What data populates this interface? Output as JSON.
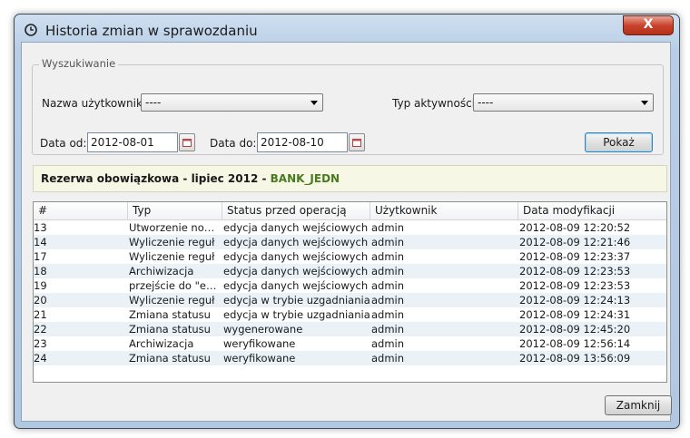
{
  "window": {
    "title": "Historia zmian w sprawozdaniu",
    "close_label": "X"
  },
  "search": {
    "legend": "Wyszukiwanie",
    "user_label": "Nazwa użytkownika:",
    "user_value": "----",
    "activity_label": "Typ aktywności:",
    "activity_value": "----",
    "date_from_label": "Data od:",
    "date_from_value": "2012-08-01",
    "date_to_label": "Data do:",
    "date_to_value": "2012-08-10",
    "show_button": "Pokaż"
  },
  "report": {
    "title": "Rezerwa obowiązkowa - lipiec 2012 - ",
    "unit": "BANK_JEDN"
  },
  "table": {
    "columns": [
      "#",
      "Typ",
      "Status przed operacją",
      "Użytkownik",
      "Data modyfikacji"
    ],
    "rows": [
      [
        "13",
        "Utworzenie nowe...",
        "edycja danych wejściowych",
        "admin",
        "2012-08-09 12:20:52"
      ],
      [
        "14",
        "Wyliczenie reguł",
        "edycja danych wejściowych",
        "admin",
        "2012-08-09 12:21:46"
      ],
      [
        "17",
        "Wyliczenie reguł",
        "edycja danych wejściowych",
        "admin",
        "2012-08-09 12:23:37"
      ],
      [
        "18",
        "Archiwizacja",
        "edycja danych wejściowych",
        "admin",
        "2012-08-09 12:23:53"
      ],
      [
        "19",
        "przejście do \"edy...",
        "edycja danych wejściowych",
        "admin",
        "2012-08-09 12:23:53"
      ],
      [
        "20",
        "Wyliczenie reguł",
        "edycja w trybie uzgadniania",
        "admin",
        "2012-08-09 12:24:13"
      ],
      [
        "21",
        "Zmiana statusu",
        "edycja w trybie uzgadniania",
        "admin",
        "2012-08-09 12:24:31"
      ],
      [
        "22",
        "Zmiana statusu",
        "wygenerowane",
        "admin",
        "2012-08-09 12:45:20"
      ],
      [
        "23",
        "Archiwizacja",
        "weryfikowane",
        "admin",
        "2012-08-09 12:56:14"
      ],
      [
        "24",
        "Zmiana statusu",
        "weryfikowane",
        "admin",
        "2012-08-09 13:56:09"
      ]
    ]
  },
  "footer": {
    "close_button": "Zamknij"
  },
  "colors": {
    "accent_green": "#4a7a1e",
    "close_red": "#c9432c",
    "row_alt": "#eaf2f7"
  }
}
